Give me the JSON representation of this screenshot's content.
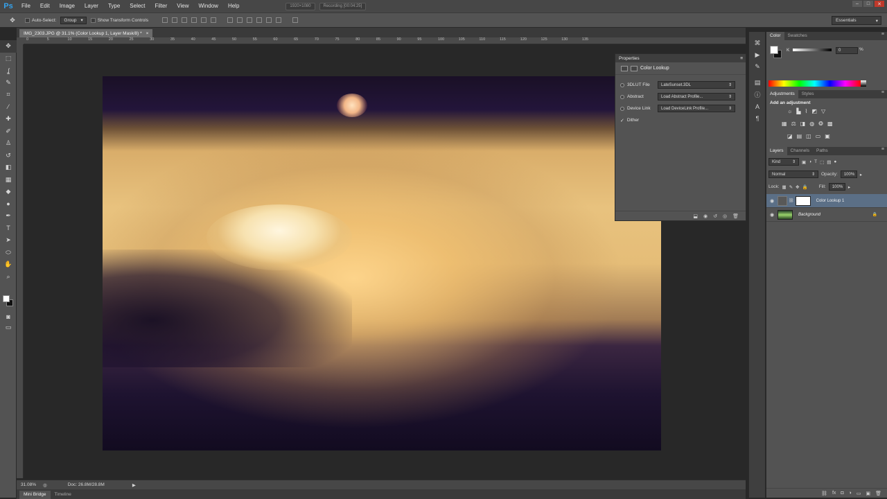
{
  "app": {
    "logo": "Ps",
    "menus": [
      "File",
      "Edit",
      "Image",
      "Layer",
      "Type",
      "Select",
      "Filter",
      "View",
      "Window",
      "Help"
    ],
    "window_buttons": [
      "–",
      "□",
      "✕"
    ],
    "recording_info": "1920×1080",
    "recording_label": "Recording [00:04:25]"
  },
  "options_bar": {
    "auto_select_label": "Auto-Select:",
    "auto_select_value": "Group",
    "show_transform_label": "Show Transform Controls",
    "workspace": "Essentials"
  },
  "document": {
    "tab_title": "IMG_2303.JPG @ 31.1% (Color Lookup 1, Layer Mask/8) *",
    "tab_close": "×",
    "ruler_ticks": [
      "0",
      "5",
      "10",
      "15",
      "20",
      "25",
      "30",
      "35",
      "40",
      "45",
      "50",
      "55",
      "60",
      "65",
      "70",
      "75",
      "80",
      "85",
      "90",
      "95",
      "100",
      "105",
      "110",
      "115",
      "120",
      "125",
      "130",
      "135"
    ]
  },
  "properties": {
    "header": "Properties",
    "title": "Color Lookup",
    "rows": [
      {
        "label": "3DLUT File",
        "value": "LateSunset.3DL"
      },
      {
        "label": "Abstract",
        "value": "Load Abstract Profile..."
      },
      {
        "label": "Device Link",
        "value": "Load DeviceLink Profile..."
      }
    ],
    "dither_label": "Dither"
  },
  "color_panel": {
    "tabs": [
      "Color",
      "Swatches"
    ],
    "channel": "K",
    "value": "0",
    "unit": "%"
  },
  "adjustments_panel": {
    "tabs": [
      "Adjustments",
      "Styles"
    ],
    "title": "Add an adjustment"
  },
  "layers_panel": {
    "tabs": [
      "Layers",
      "Channels",
      "Paths"
    ],
    "kind_filter": "Kind",
    "blend_mode": "Normal",
    "opacity_label": "Opacity:",
    "opacity_value": "100%",
    "lock_label": "Lock:",
    "fill_label": "Fill:",
    "fill_value": "100%",
    "layers": [
      {
        "name": "Color Lookup 1",
        "selected": true
      },
      {
        "name": "Background",
        "selected": false
      }
    ]
  },
  "status": {
    "zoom": "31.08%",
    "doc_size": "Doc: 26.8M/28.8M"
  },
  "bottom_tabs": [
    "Mini Bridge",
    "Timeline"
  ]
}
